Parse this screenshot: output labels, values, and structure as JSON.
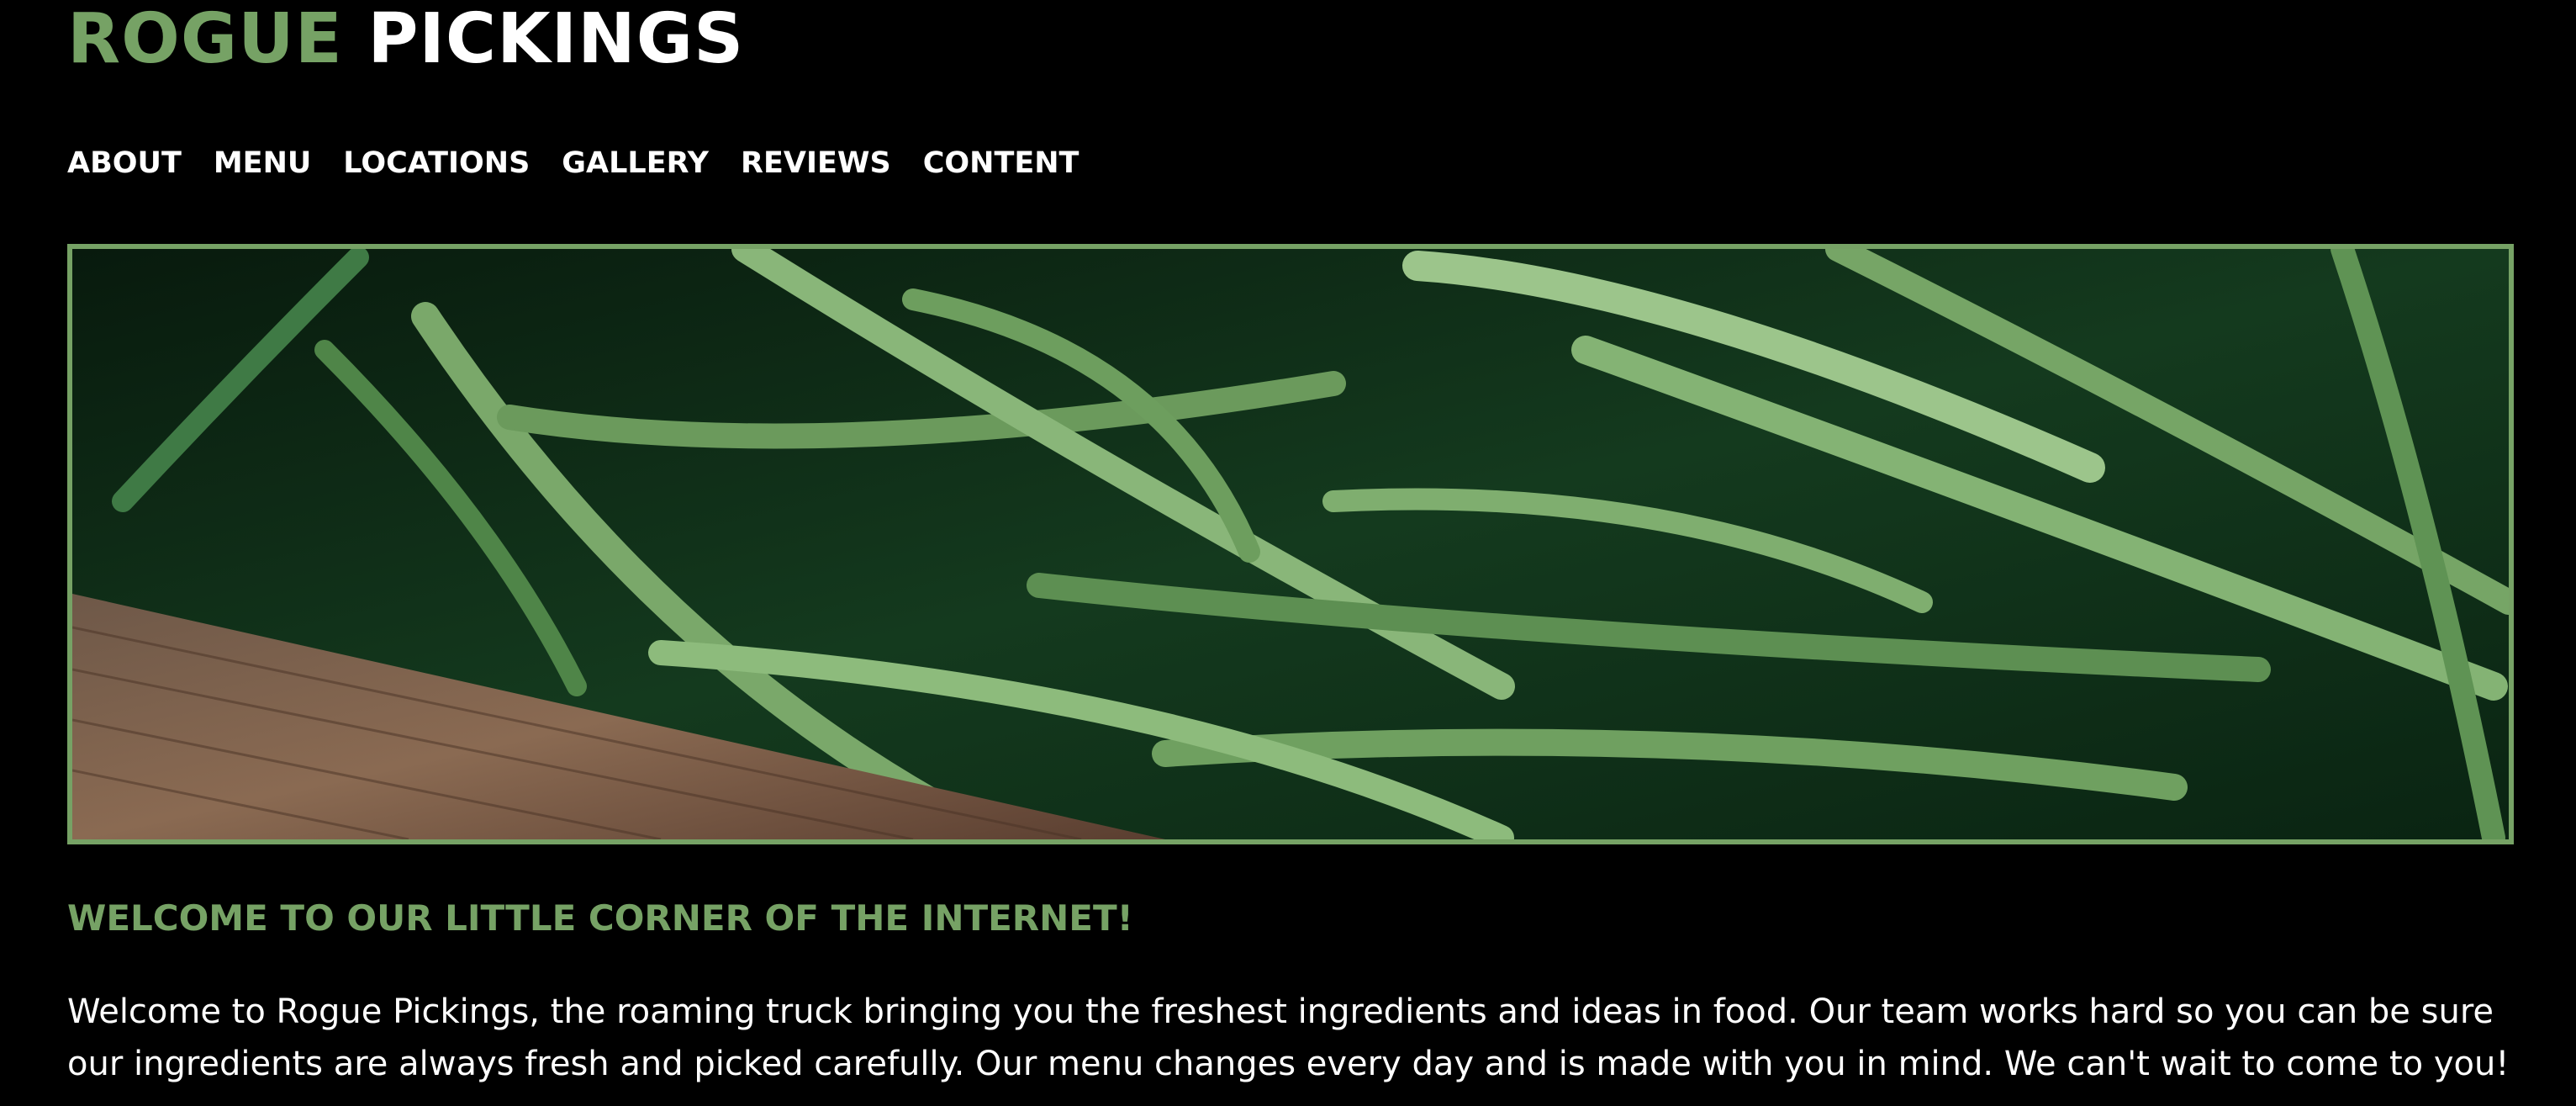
{
  "brand": {
    "word1": "ROGUE",
    "word2": "PICKINGS",
    "accent_color": "#76a265",
    "text_color": "#ffffff",
    "background": "#000000"
  },
  "nav": {
    "items": [
      {
        "label": "ABOUT"
      },
      {
        "label": "MENU"
      },
      {
        "label": "LOCATIONS"
      },
      {
        "label": "GALLERY"
      },
      {
        "label": "REVIEWS"
      },
      {
        "label": "CONTENT"
      }
    ]
  },
  "hero": {
    "image": "green-beans-photo",
    "border_color": "#76a265"
  },
  "welcome": {
    "heading": "WELCOME TO OUR LITTLE CORNER OF THE INTERNET!",
    "paragraph": "Welcome to Rogue Pickings, the roaming truck bringing you the freshest ingredients and ideas in food. Our team works hard so you can be sure our ingredients are always fresh and picked carefully. Our menu changes every day and is made with you in mind. We can't wait to come to you!"
  }
}
